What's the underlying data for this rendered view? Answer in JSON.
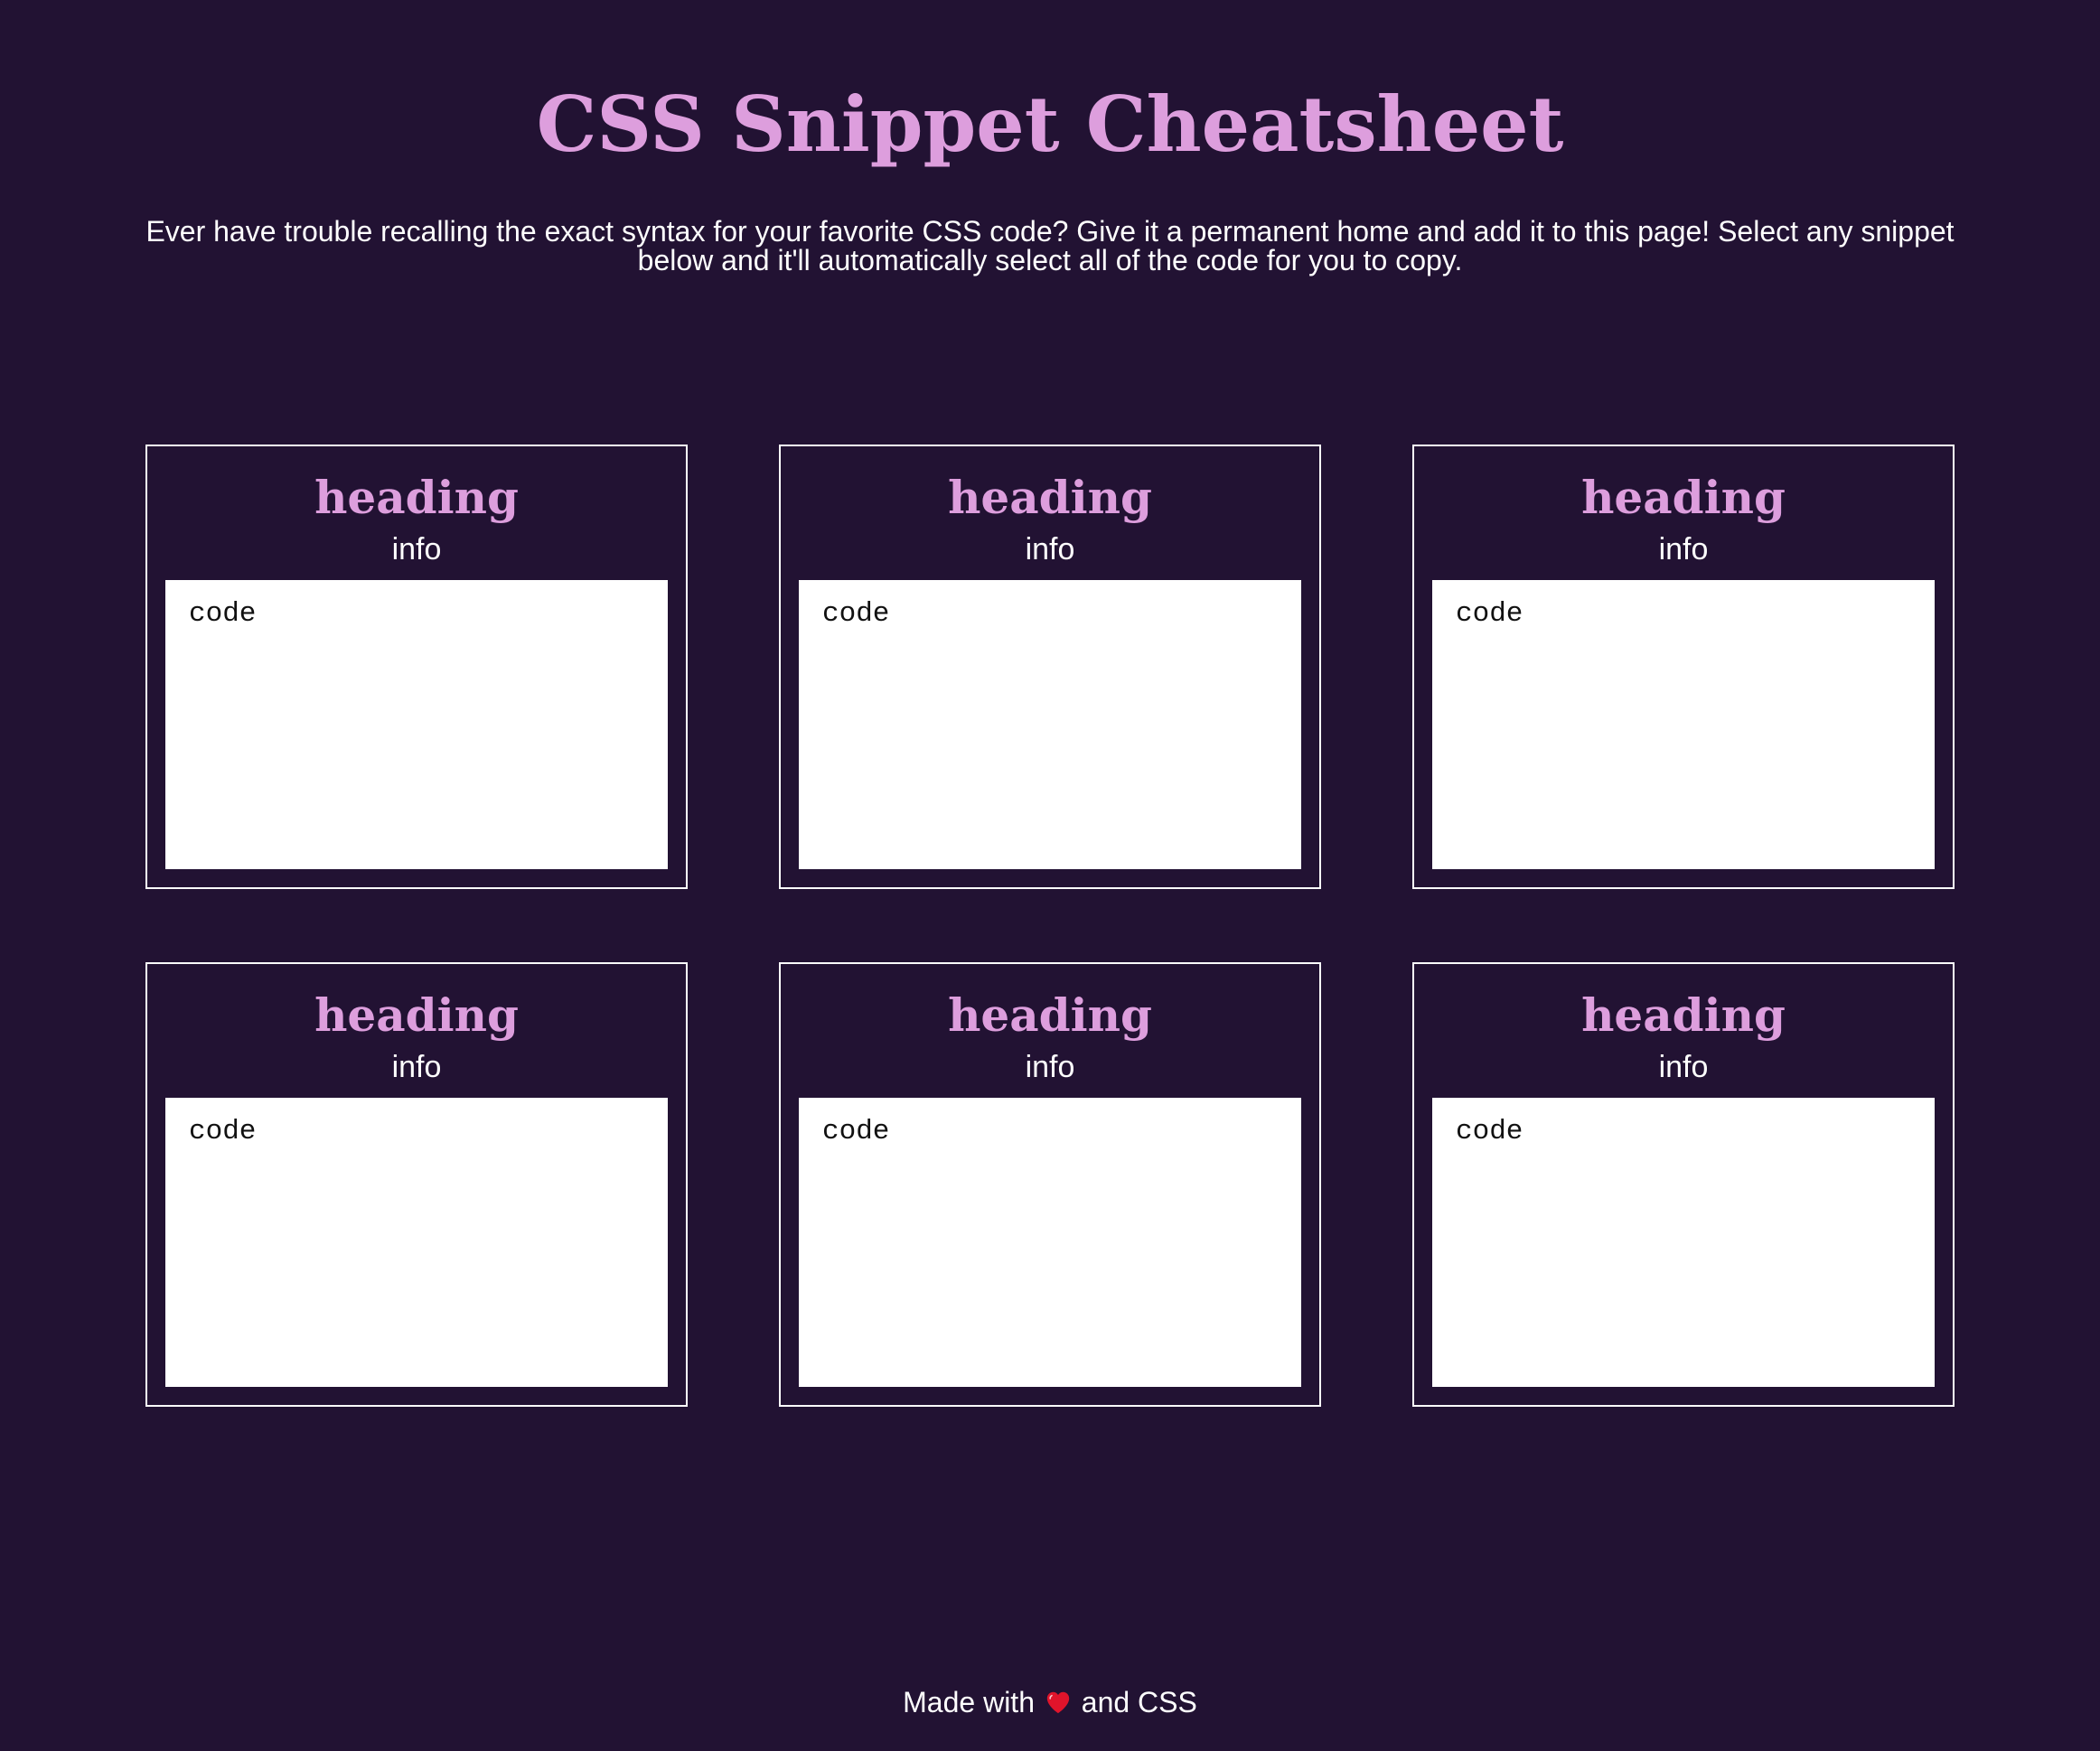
{
  "header": {
    "title": "CSS Snippet Cheatsheet",
    "intro": "Ever have trouble recalling the exact syntax for your favorite CSS code? Give it a permanent home and add it to this page! Select any snippet below and it'll automatically select all of the code for you to copy."
  },
  "snippets": [
    {
      "heading": "heading",
      "info": "info",
      "code": "code"
    },
    {
      "heading": "heading",
      "info": "info",
      "code": "code"
    },
    {
      "heading": "heading",
      "info": "info",
      "code": "code"
    },
    {
      "heading": "heading",
      "info": "info",
      "code": "code"
    },
    {
      "heading": "heading",
      "info": "info",
      "code": "code"
    },
    {
      "heading": "heading",
      "info": "info",
      "code": "code"
    }
  ],
  "footer": {
    "prefix": "Made with",
    "icon": "heart-icon",
    "suffix": "and CSS"
  },
  "colors": {
    "background": "#221233",
    "accent": "#dd9edd",
    "text": "#ffffff",
    "code_background": "#ffffff",
    "heart": "#e0142b"
  }
}
